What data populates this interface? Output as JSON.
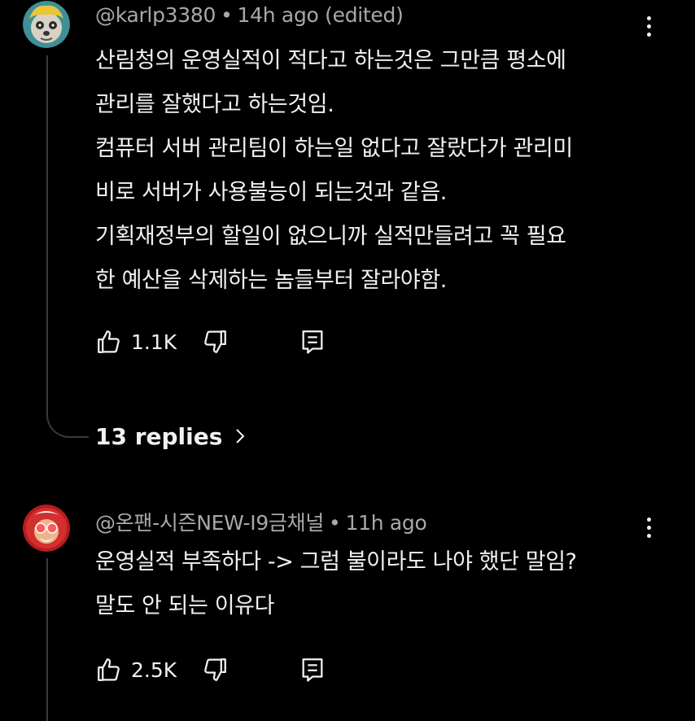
{
  "comments": [
    {
      "author": "@karlp3380",
      "time": "14h ago (edited)",
      "lines": [
        "산림청의 운영실적이 적다고 하는것은 그만큼 평소에",
        "관리를 잘했다고 하는것임.",
        "컴퓨터 서버 관리팀이 하는일 없다고 잘랐다가 관리미",
        "비로 서버가 사용불능이 되는것과 같음.",
        "기획재정부의 할일이 없으니까 실적만들려고 꼭 필요",
        "한 예산을 삭제하는 놈들부터 잘라야함."
      ],
      "likes": "1.1K",
      "replies_label": "13 replies"
    },
    {
      "author": "@온팬-시즌NEW-I9금채널",
      "time": "11h ago",
      "lines": [
        "운영실적 부족하다 -> 그럼 불이라도 나야 했단 말임?",
        "말도 안 되는 이유다"
      ],
      "likes": "2.5K"
    }
  ],
  "separator": "•",
  "icons": {
    "like": "thumbs-up-icon",
    "dislike": "thumbs-down-icon",
    "reply": "reply-icon",
    "more": "more-vert-icon",
    "chevron": "chevron-right-icon"
  },
  "colors": {
    "background": "#000000",
    "text": "#f1f1f1",
    "meta": "#a8a8a8",
    "thread_line": "#3a3a3a"
  }
}
